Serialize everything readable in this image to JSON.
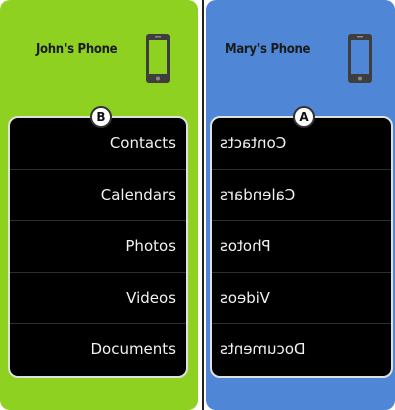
{
  "colors": {
    "left_panel": "#8fd120",
    "right_panel": "#4f86d6",
    "list_background": "#000000",
    "list_text": "#f2f2f2"
  },
  "left": {
    "device_name": "John's Phone",
    "device_icon": "smartphone-icon",
    "badge": "B",
    "items": [
      "Contacts",
      "Calendars",
      "Photos",
      "Videos",
      "Documents"
    ]
  },
  "right": {
    "device_name": "Mary's Phone",
    "device_icon": "smartphone-icon",
    "badge": "A",
    "items": [
      "Contacts",
      "Calendars",
      "Photos",
      "Videos",
      "Documents"
    ]
  }
}
